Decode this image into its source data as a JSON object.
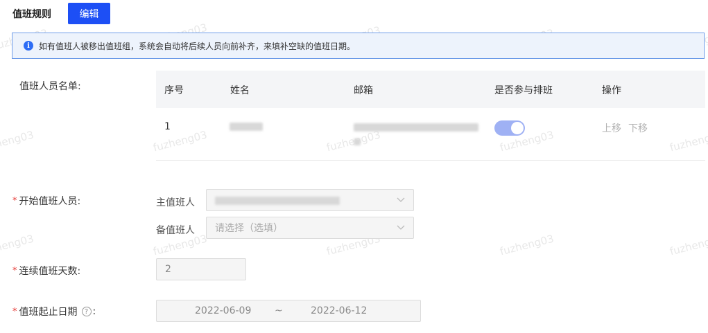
{
  "header": {
    "title": "值班规则",
    "edit_label": "编辑"
  },
  "notice": {
    "text": "如有值班人被移出值班组，系统会自动将后续人员向前补齐，来填补空缺的值班日期。"
  },
  "watermark": "fuzheng03",
  "roster": {
    "label": "值班人员名单:",
    "columns": [
      "序号",
      "姓名",
      "邮箱",
      "是否参与排班",
      "操作"
    ],
    "rows": [
      {
        "index": "1",
        "participate": true,
        "move_up": "上移",
        "move_down": "下移"
      }
    ]
  },
  "start": {
    "label": "开始值班人员:",
    "primary_label": "主值班人",
    "backup_label": "备值班人",
    "backup_placeholder": "请选择（选填）"
  },
  "days": {
    "label": "连续值班天数:",
    "value": "2"
  },
  "date_range": {
    "label": "值班起止日期",
    "colon": ":",
    "start": "2022-06-09",
    "separator": "~",
    "end": "2022-06-12"
  },
  "colors": {
    "primary": "#1d4ff5",
    "toggle_on": "#9fb1f4",
    "required": "#e53935",
    "notice_border": "#6c9be8"
  }
}
